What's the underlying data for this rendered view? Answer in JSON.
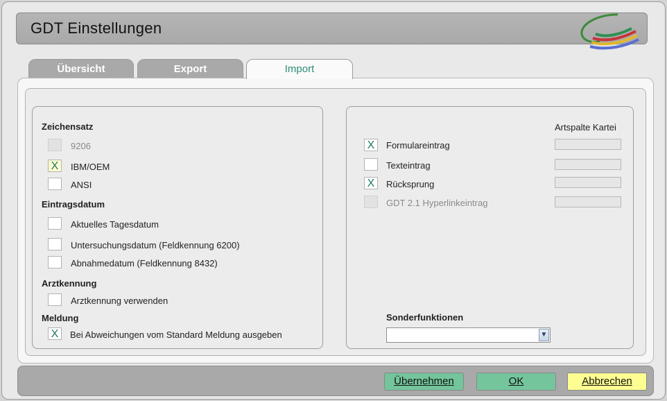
{
  "window": {
    "title": "GDT Einstellungen"
  },
  "tabs": [
    {
      "label": "Übersicht",
      "active": false
    },
    {
      "label": "Export",
      "active": false
    },
    {
      "label": "Import",
      "active": true
    }
  ],
  "left": {
    "zeichensatz": {
      "heading": "Zeichensatz",
      "items": [
        {
          "label": "9206",
          "checked": false,
          "mark": "",
          "enabled": false
        },
        {
          "label": "IBM/OEM",
          "checked": true,
          "mark": "X",
          "enabled": true
        },
        {
          "label": "ANSI",
          "checked": false,
          "mark": "",
          "enabled": true
        }
      ]
    },
    "eintragsdatum": {
      "heading": "Eintragsdatum",
      "items": [
        {
          "label": "Aktuelles Tagesdatum",
          "checked": false,
          "mark": ""
        },
        {
          "label": "Untersuchungsdatum (Feldkennung 6200)",
          "checked": false,
          "mark": ""
        },
        {
          "label": "Abnahmedatum (Feldkennung 8432)",
          "checked": false,
          "mark": ""
        }
      ]
    },
    "arztkennung": {
      "heading": "Arztkennung",
      "items": [
        {
          "label": "Arztkennung verwenden",
          "checked": false,
          "mark": ""
        }
      ]
    },
    "meldung": {
      "heading": "Meldung",
      "items": [
        {
          "label": "Bei Abweichungen vom Standard Meldung ausgeben",
          "checked": true,
          "mark": "X"
        }
      ]
    }
  },
  "right": {
    "artspalte_header": "Artspalte Kartei",
    "items": [
      {
        "label": "Formulareintrag",
        "checked": true,
        "mark": "X",
        "enabled": true,
        "artspalte": ""
      },
      {
        "label": "Texteintrag",
        "checked": false,
        "mark": "",
        "enabled": true,
        "artspalte": ""
      },
      {
        "label": "Rücksprung",
        "checked": true,
        "mark": "X",
        "enabled": true,
        "artspalte": ""
      },
      {
        "label": "GDT 2.1 Hyperlinkeintrag",
        "checked": false,
        "mark": "",
        "enabled": false,
        "artspalte": ""
      }
    ],
    "sonderfunktionen": {
      "label": "Sonderfunktionen",
      "value": ""
    }
  },
  "buttons": {
    "apply": "Übernehmen",
    "ok": "OK",
    "cancel": "Abbrechen"
  },
  "colors": {
    "accent": "#2f8c78",
    "green_button": "#74c59c",
    "yellow_button": "#fdfd92",
    "titlebar": "#ababab"
  },
  "icons": {
    "logo": "swoosh-logo-icon",
    "dropdown": "chevron-down-icon"
  }
}
